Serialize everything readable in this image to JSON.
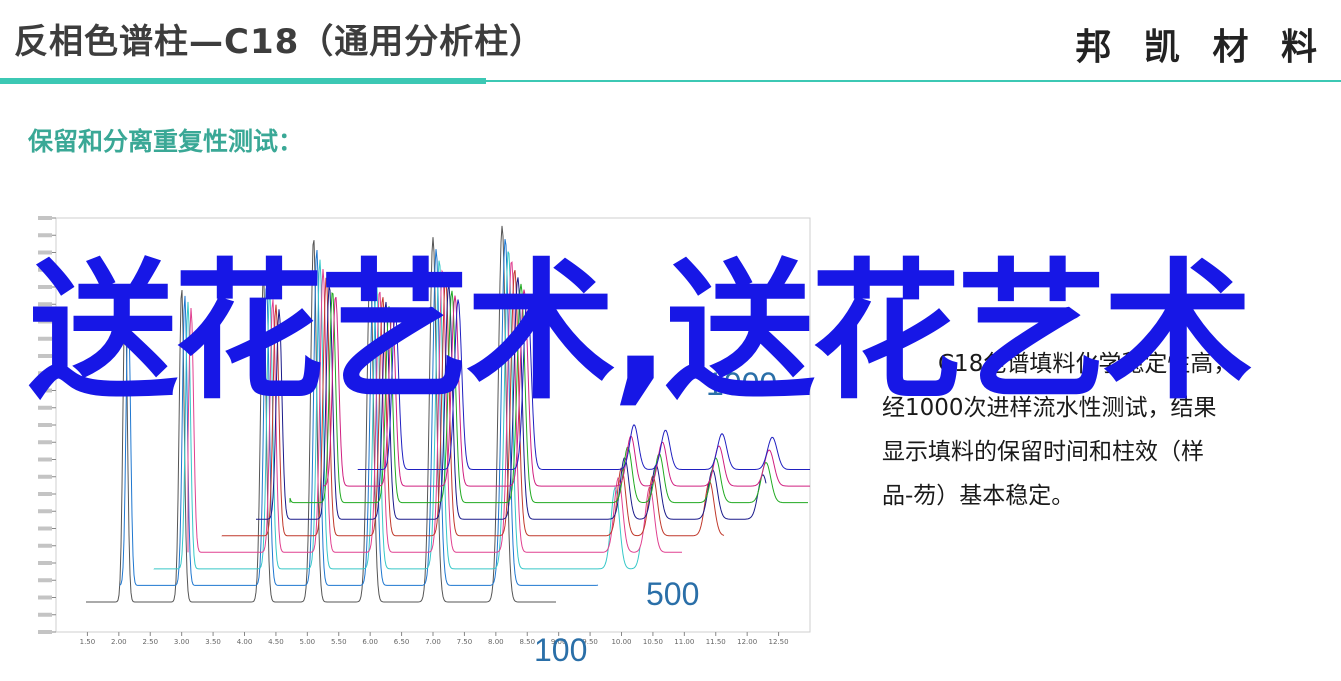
{
  "header": {
    "title": "反相色谱柱—C18（通用分析柱）",
    "brand": "邦 凯 材 料"
  },
  "subtitle": "保留和分离重复性测试：",
  "description": {
    "line1": "C18色谱填料化学稳定性高，",
    "line2": "经1000次进样流水性测试，结果",
    "line3": "显示填料的保留时间和柱效（样",
    "line4": "品-芴）基本稳定。"
  },
  "watermark": "送花艺术,送花艺术",
  "chart_labels": {
    "top": "1000",
    "mid": "500",
    "bottom": "100"
  },
  "colors": {
    "accent": "#3cc8b4",
    "subtitle": "#3aa896",
    "watermark": "#1717e6",
    "label": "#2a6fa8"
  },
  "chart_data": {
    "type": "line",
    "x_ticks": [
      "1.50",
      "2.00",
      "2.50",
      "3.00",
      "3.50",
      "4.00",
      "4.50",
      "5.00",
      "5.50",
      "6.00",
      "6.50",
      "7.00",
      "7.50",
      "8.00",
      "8.50",
      "9.00",
      "9.50",
      "10.00",
      "10.50",
      "11.00",
      "11.50",
      "12.00",
      "12.50"
    ],
    "xlim": [
      1.0,
      13.0
    ],
    "ylim": [
      0,
      1.0
    ],
    "peaks": [
      {
        "rt": 2.1,
        "h": 0.8
      },
      {
        "rt": 3.0,
        "h": 0.82
      },
      {
        "rt": 4.3,
        "h": 0.85
      },
      {
        "rt": 5.1,
        "h": 0.95
      },
      {
        "rt": 6.0,
        "h": 0.88
      },
      {
        "rt": 7.0,
        "h": 0.95
      },
      {
        "rt": 8.1,
        "h": 0.98
      },
      {
        "rt": 9.8,
        "h": 0.25
      },
      {
        "rt": 10.3,
        "h": 0.22
      },
      {
        "rt": 11.2,
        "h": 0.2
      },
      {
        "rt": 12.0,
        "h": 0.18
      }
    ],
    "series": [
      {
        "color": "#555555",
        "offset": 0.0,
        "shift": 0.0
      },
      {
        "color": "#1f77d0",
        "offset": 0.04,
        "shift": 0.05
      },
      {
        "color": "#37c8c8",
        "offset": 0.08,
        "shift": 0.1
      },
      {
        "color": "#e04090",
        "offset": 0.12,
        "shift": 0.15
      },
      {
        "color": "#c0392b",
        "offset": 0.16,
        "shift": 0.2
      },
      {
        "color": "#1a1a8a",
        "offset": 0.2,
        "shift": 0.25
      },
      {
        "color": "#22aa22",
        "offset": 0.24,
        "shift": 0.3
      },
      {
        "color": "#d02080",
        "offset": 0.28,
        "shift": 0.35
      },
      {
        "color": "#2020c0",
        "offset": 0.32,
        "shift": 0.4
      }
    ]
  }
}
